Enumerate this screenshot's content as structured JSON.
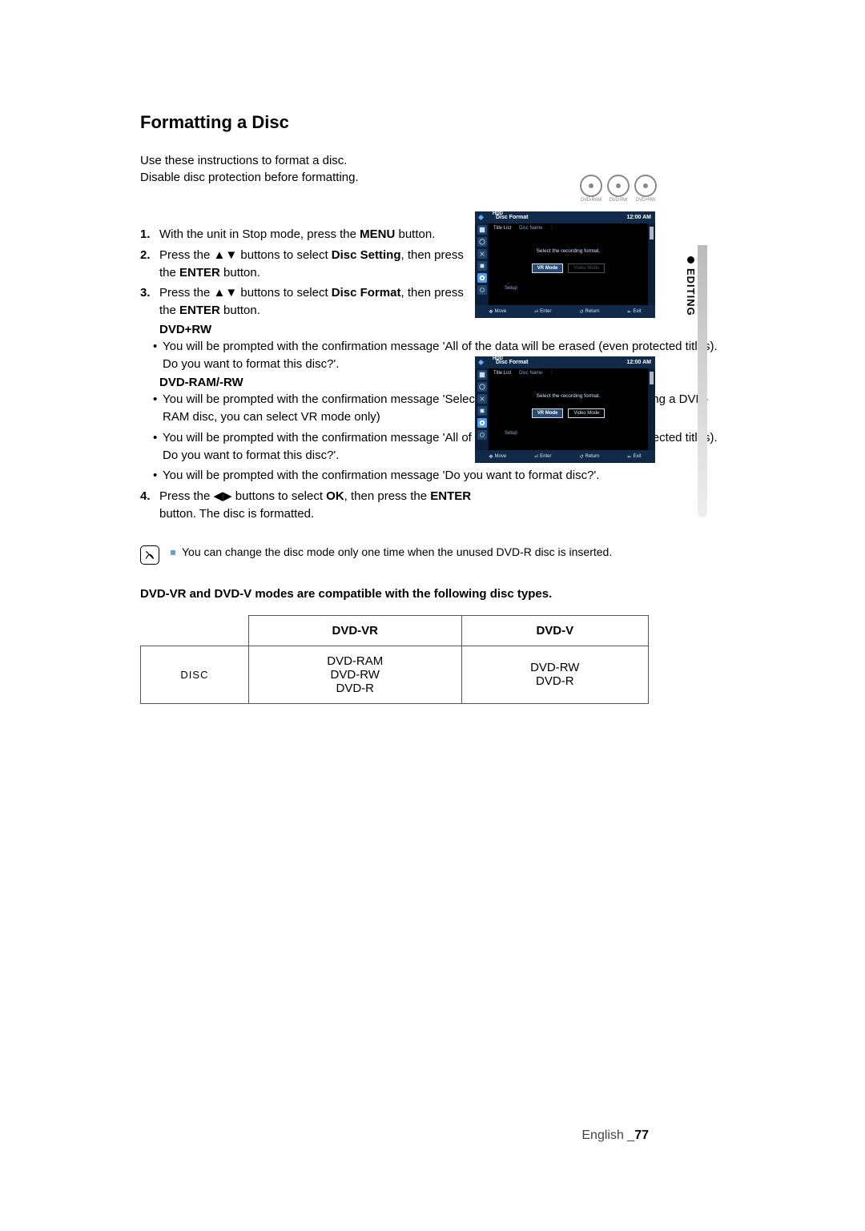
{
  "title": "Formatting a Disc",
  "intro_l1": "Use these instructions to format a disc.",
  "intro_l2": "Disable disc protection before formatting.",
  "steps": {
    "s1_pre": "With the unit in Stop mode, press the ",
    "s1_bold": "MENU",
    "s1_post": " button.",
    "s2_pre": "Press the ▲▼ buttons to select ",
    "s2_bold": "Disc Setting",
    "s2_mid": ", then press the ",
    "s2_bold2": "ENTER",
    "s2_post": " button.",
    "s3_pre": "Press the ▲▼ buttons to select ",
    "s3_bold": "Disc Format",
    "s3_mid": ", then press the ",
    "s3_bold2": "ENTER",
    "s3_post": " button.",
    "dvdrw_head": "DVD+RW",
    "dvdrw_b1": "You will be prompted with the confirmation message 'All of the data will be erased (even protected titles). Do you want to format this disc?'.",
    "dvdram_head": "DVD-RAM/-RW",
    "dvdram_b1": "You will be prompted with the confirmation message 'Select the recording format.' (When using a DVD-RAM disc, you can select VR mode only)",
    "dvdram_b2": "You will be prompted with the confirmation message 'All of the data will be erased (even protected titles). Do you want to format this disc?'.",
    "dvdram_b3": "You will be prompted with the confirmation message 'Do you want to format disc?'.",
    "s4_pre": "Press the ◀▶ buttons to select ",
    "s4_bold": "OK",
    "s4_mid": ", then press the ",
    "s4_bold2": "ENTER",
    "s4_post": " button. The disc is formatted."
  },
  "note_text": "You can change the disc mode only one time when the unused DVD-R disc is inserted.",
  "compat_line": "DVD-VR and DVD-V modes are compatible with the following disc types.",
  "table": {
    "h1": "DVD-VR",
    "h2": "DVD-V",
    "row_label": "DISC",
    "c1_l1": "DVD-RAM",
    "c1_l2": "DVD-RW",
    "c1_l3": "DVD-R",
    "c2_l1": "DVD-RW",
    "c2_l2": "DVD-R"
  },
  "side_label": "EDITING",
  "disc_labels": {
    "a": "DVD-RAM",
    "b": "DVD-RW",
    "c": "DVD+RW"
  },
  "osd": {
    "title": "Disc Format",
    "time": "12:00 AM",
    "hdd": "HDD",
    "list_col1": "Title List",
    "list_col2": "Disc Name",
    "list_col3": ":",
    "msg": "Select the recording format.",
    "vr": "VR Mode",
    "video": "Video Mode",
    "setup": "Setup",
    "f_move": "Move",
    "f_enter": "Enter",
    "f_return": "Return",
    "f_exit": "Exit"
  },
  "footer_lang": "English _",
  "footer_page": "77"
}
